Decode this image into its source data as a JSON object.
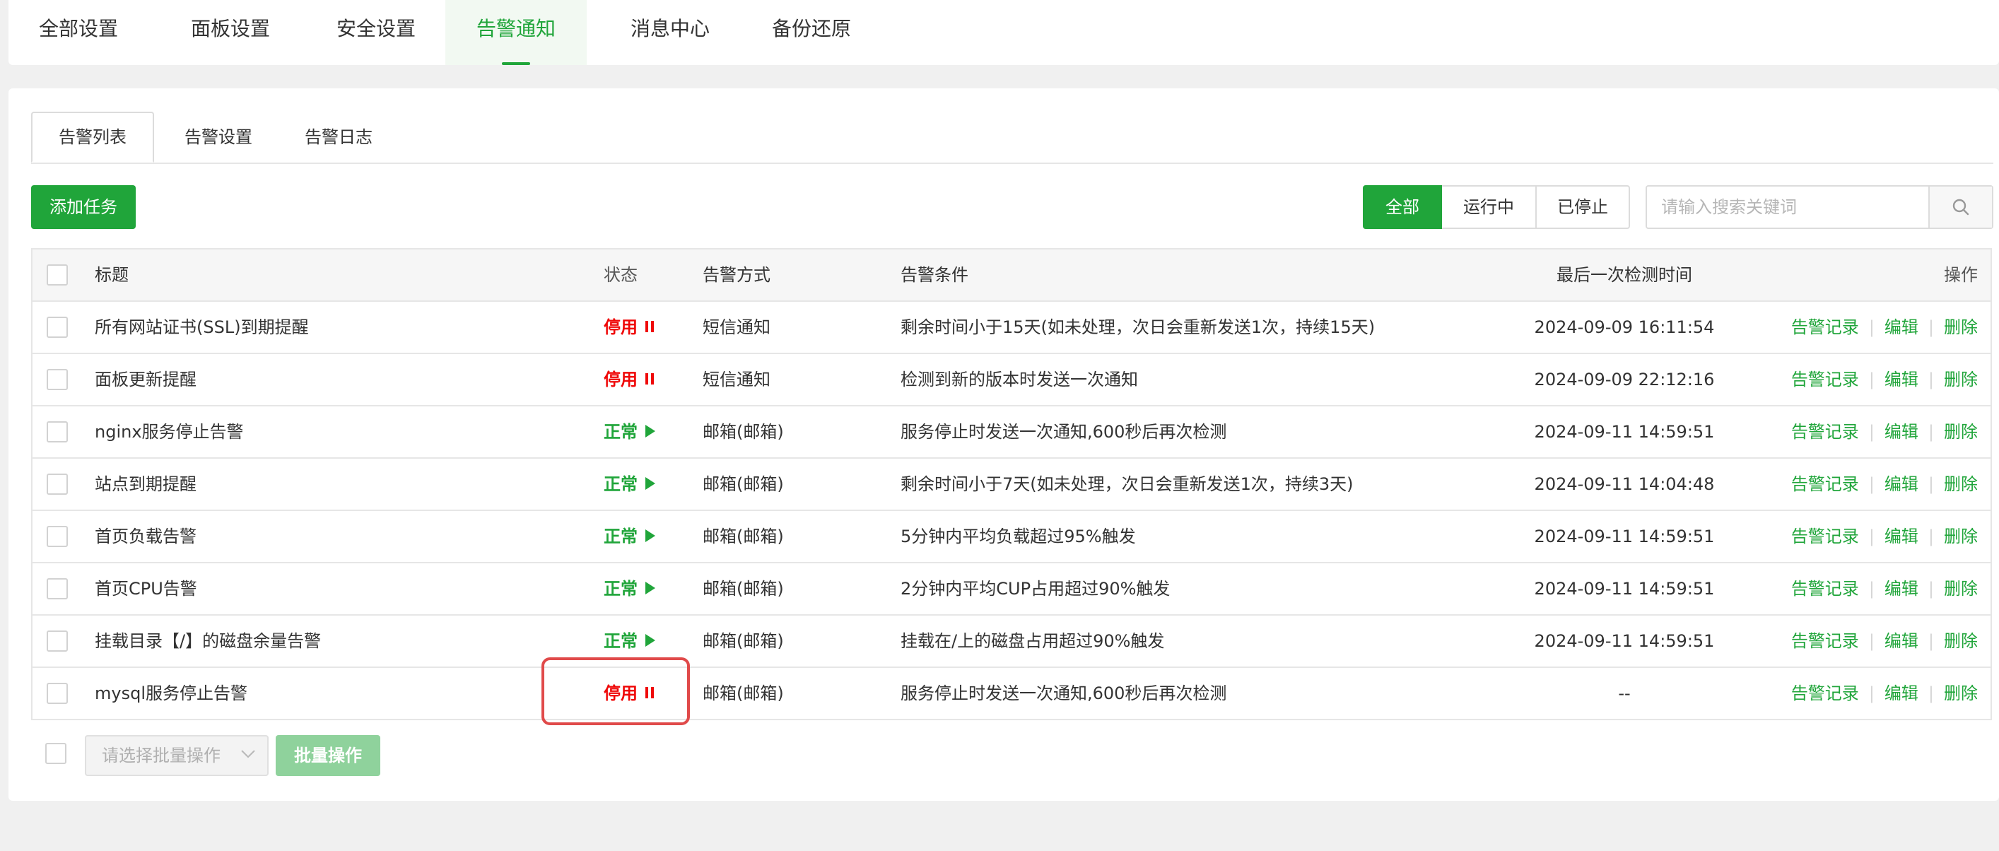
{
  "nav": {
    "tabs": [
      {
        "label": "全部设置"
      },
      {
        "label": "面板设置"
      },
      {
        "label": "安全设置"
      },
      {
        "label": "告警通知",
        "active": true
      },
      {
        "label": "消息中心"
      },
      {
        "label": "备份还原"
      }
    ]
  },
  "subtabs": [
    "告警列表",
    "告警设置",
    "告警日志"
  ],
  "toolbar": {
    "add_label": "添加任务",
    "filters": [
      "全部",
      "运行中",
      "已停止"
    ],
    "search_placeholder": "请输入搜索关键词"
  },
  "table": {
    "headers": {
      "title": "标题",
      "status": "状态",
      "method": "告警方式",
      "condition": "告警条件",
      "last_check": "最后一次检测时间",
      "ops": "操作"
    },
    "ops": {
      "log": "告警记录",
      "edit": "编辑",
      "delete": "删除"
    },
    "rows": [
      {
        "title": "所有网站证书(SSL)到期提醒",
        "status": "停用",
        "state": "stopped",
        "method": "短信通知",
        "condition": "剩余时间小于15天(如未处理，次日会重新发送1次，持续15天)",
        "last_check": "2024-09-09 16:11:54"
      },
      {
        "title": "面板更新提醒",
        "status": "停用",
        "state": "stopped",
        "method": "短信通知",
        "condition": "检测到新的版本时发送一次通知",
        "last_check": "2024-09-09 22:12:16"
      },
      {
        "title": "nginx服务停止告警",
        "status": "正常",
        "state": "running",
        "method": "邮箱(邮箱)",
        "condition": "服务停止时发送一次通知,600秒后再次检测",
        "last_check": "2024-09-11 14:59:51"
      },
      {
        "title": "站点到期提醒",
        "status": "正常",
        "state": "running",
        "method": "邮箱(邮箱)",
        "condition": "剩余时间小于7天(如未处理，次日会重新发送1次，持续3天)",
        "last_check": "2024-09-11 14:04:48"
      },
      {
        "title": "首页负载告警",
        "status": "正常",
        "state": "running",
        "method": "邮箱(邮箱)",
        "condition": "5分钟内平均负载超过95%触发",
        "last_check": "2024-09-11 14:59:51"
      },
      {
        "title": "首页CPU告警",
        "status": "正常",
        "state": "running",
        "method": "邮箱(邮箱)",
        "condition": "2分钟内平均CUP占用超过90%触发",
        "last_check": "2024-09-11 14:59:51"
      },
      {
        "title": "挂载目录【/】的磁盘余量告警",
        "status": "正常",
        "state": "running",
        "method": "邮箱(邮箱)",
        "condition": "挂载在/上的磁盘占用超过90%触发",
        "last_check": "2024-09-11 14:59:51"
      },
      {
        "title": "mysql服务停止告警",
        "status": "停用",
        "state": "stopped",
        "method": "邮箱(邮箱)",
        "condition": "服务停止时发送一次通知,600秒后再次检测",
        "last_check": "--"
      }
    ]
  },
  "footer": {
    "batch_placeholder": "请选择批量操作",
    "batch_label": "批量操作"
  },
  "colors": {
    "accent": "#20a53a",
    "danger": "#ef0808",
    "highlight": "#e04a4a"
  }
}
